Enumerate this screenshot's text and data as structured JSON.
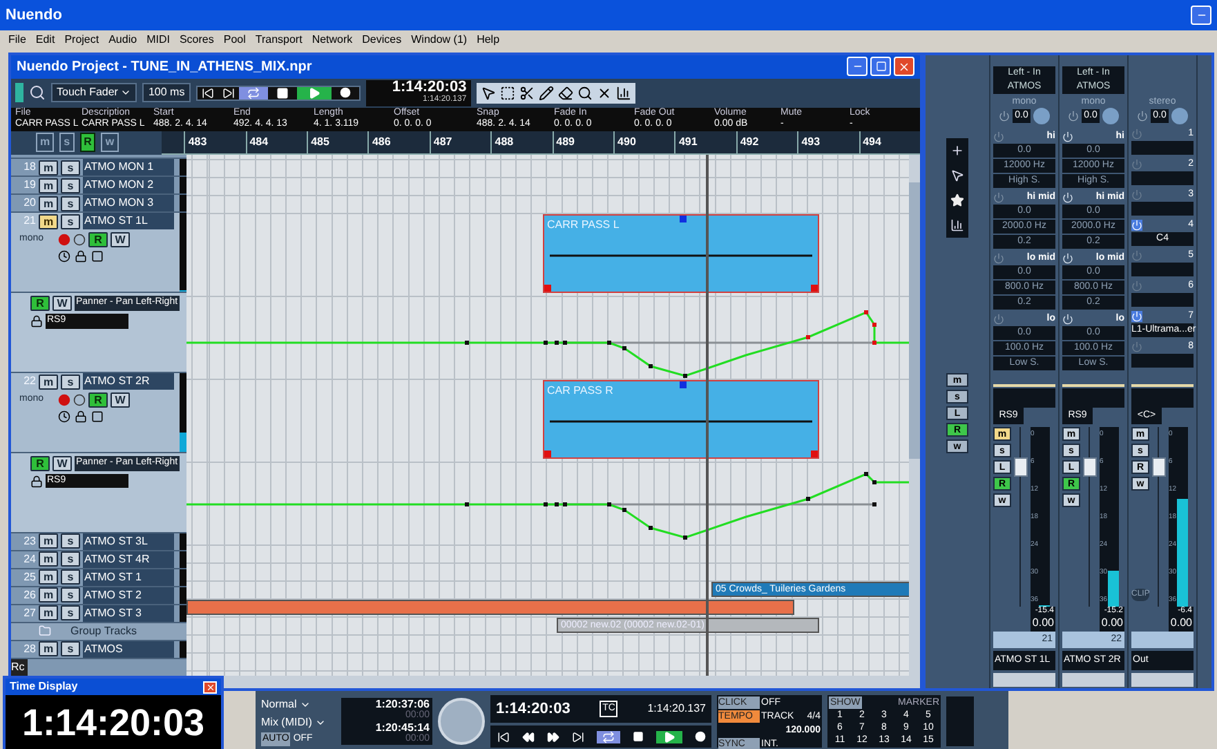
{
  "app": {
    "title": "Nuendo"
  },
  "menu": [
    "File",
    "Edit",
    "Project",
    "Audio",
    "MIDI",
    "Scores",
    "Pool",
    "Transport",
    "Network",
    "Devices",
    "Window (1)",
    "Help"
  ],
  "project": {
    "title": "Nuendo Project - TUNE_IN_ATHENS_MIX.npr",
    "toolbar": {
      "automation_mode": "Touch Fader",
      "fade_time": "100 ms",
      "time": "1:14:20:03",
      "time_secondary": "1:14:20.137",
      "cycle": true,
      "playing": true
    },
    "info": [
      {
        "label": "File",
        "value": "CARR PASS L"
      },
      {
        "label": "Description",
        "value": "CARR PASS L"
      },
      {
        "label": "Start",
        "value": "488. 2. 4. 14"
      },
      {
        "label": "End",
        "value": "492. 4. 4. 13"
      },
      {
        "label": "Length",
        "value": "4. 1. 3.119"
      },
      {
        "label": "Offset",
        "value": "0. 0. 0. 0"
      },
      {
        "label": "Snap",
        "value": "488. 2. 4. 14"
      },
      {
        "label": "Fade In",
        "value": "0. 0. 0. 0"
      },
      {
        "label": "Fade Out",
        "value": "0. 0. 0. 0"
      },
      {
        "label": "Volume",
        "value": "0.00 dB"
      },
      {
        "label": "Mute",
        "value": "-"
      },
      {
        "label": "Lock",
        "value": "-"
      }
    ],
    "header_buttons": [
      {
        "label": "m",
        "on": false
      },
      {
        "label": "s",
        "on": false
      },
      {
        "label": "R",
        "on": true
      },
      {
        "label": "w",
        "on": false
      }
    ],
    "ruler": [
      "483",
      "484",
      "485",
      "486",
      "487",
      "488",
      "489",
      "490",
      "491",
      "492",
      "493",
      "494"
    ],
    "tracks": [
      {
        "kind": "audio",
        "number": "18",
        "name": "ATMO MON 1",
        "buttons": [
          {
            "label": "m",
            "on": false
          },
          {
            "label": "s",
            "on": false
          }
        ]
      },
      {
        "kind": "audio",
        "number": "19",
        "name": "ATMO MON 2",
        "buttons": [
          {
            "label": "m",
            "on": false
          },
          {
            "label": "s",
            "on": false
          }
        ]
      },
      {
        "kind": "audio",
        "number": "20",
        "name": "ATMO MON 3",
        "buttons": [
          {
            "label": "m",
            "on": false
          },
          {
            "label": "s",
            "on": false
          }
        ]
      },
      {
        "kind": "expanded",
        "number": "21",
        "name": "ATMO ST 1L",
        "buttons": [
          {
            "label": "m",
            "on": true
          },
          {
            "label": "s",
            "on": false
          }
        ],
        "mode": "mono",
        "rw": [
          {
            "label": "R",
            "on": true
          },
          {
            "label": "W",
            "on": false
          }
        ],
        "meter": {
          "level": 0
        },
        "event": {
          "name": "CARR PASS L"
        }
      },
      {
        "kind": "automation",
        "parameter": "Panner - Pan Left-Right",
        "value": "RS9",
        "rw": [
          {
            "label": "R",
            "on": true
          },
          {
            "label": "W",
            "on": false
          }
        ]
      },
      {
        "kind": "expanded",
        "number": "22",
        "name": "ATMO ST 2R",
        "buttons": [
          {
            "label": "m",
            "on": false
          },
          {
            "label": "s",
            "on": false
          }
        ],
        "mode": "mono",
        "rw": [
          {
            "label": "R",
            "on": true
          },
          {
            "label": "W",
            "on": false
          }
        ],
        "meter": {
          "level": 0.25
        },
        "event": {
          "name": "CAR PASS R"
        }
      },
      {
        "kind": "automation",
        "parameter": "Panner - Pan Left-Right",
        "value": "RS9",
        "rw": [
          {
            "label": "R",
            "on": true
          },
          {
            "label": "W",
            "on": false
          }
        ]
      },
      {
        "kind": "audio",
        "number": "23",
        "name": "ATMO ST 3L",
        "buttons": [
          {
            "label": "m",
            "on": false
          },
          {
            "label": "s",
            "on": false
          }
        ]
      },
      {
        "kind": "audio",
        "number": "24",
        "name": "ATMO ST 4R",
        "buttons": [
          {
            "label": "m",
            "on": false
          },
          {
            "label": "s",
            "on": false
          }
        ]
      },
      {
        "kind": "audio",
        "number": "25",
        "name": "ATMO ST 1",
        "buttons": [
          {
            "label": "m",
            "on": false
          },
          {
            "label": "s",
            "on": false
          }
        ],
        "event": {
          "name": "05 Crowds_ Tuileries Gardens",
          "color": "#1f7ab8"
        }
      },
      {
        "kind": "audio",
        "number": "26",
        "name": "ATMO ST 2",
        "buttons": [
          {
            "label": "m",
            "on": false
          },
          {
            "label": "s",
            "on": false
          }
        ],
        "event": {
          "color": "#e8704a"
        }
      },
      {
        "kind": "audio",
        "number": "27",
        "name": "ATMO ST 3",
        "buttons": [
          {
            "label": "m",
            "on": false
          },
          {
            "label": "s",
            "on": false
          }
        ],
        "event": {
          "name": "00002 new.02 (00002 new.02-01)",
          "color": "#b4b8bc"
        }
      },
      {
        "kind": "folder",
        "name": "Group Tracks"
      },
      {
        "kind": "audio",
        "number": "28",
        "name": "ATMOS",
        "buttons": [
          {
            "label": "m",
            "on": false
          },
          {
            "label": "s",
            "on": false
          }
        ]
      }
    ],
    "footer": "Rc"
  },
  "mixer": {
    "global_buttons": [
      {
        "label": "m",
        "on": false
      },
      {
        "label": "s",
        "on": false
      },
      {
        "label": "L",
        "on": false
      },
      {
        "label": "R",
        "on": true
      },
      {
        "label": "w",
        "on": false
      }
    ],
    "strips": [
      {
        "kind": "channel",
        "input": "Left - In",
        "output": "ATMOS",
        "mode": "mono",
        "gain": "0.0",
        "eq_enabled": false,
        "eq": [
          {
            "band": "hi",
            "gain": "0.0",
            "freq": "12000 Hz",
            "shape": "High S."
          },
          {
            "band": "hi mid",
            "gain": "0.0",
            "freq": "2000.0 Hz",
            "shape": "0.2"
          },
          {
            "band": "lo mid",
            "gain": "0.0",
            "freq": "800.0 Hz",
            "shape": "0.2"
          },
          {
            "band": "lo",
            "gain": "0.0",
            "freq": "100.0 Hz",
            "shape": "Low S."
          }
        ],
        "pan": "RS9",
        "buttons": [
          {
            "label": "m",
            "on": true
          },
          {
            "label": "s",
            "on": false
          },
          {
            "label": "L",
            "on": false
          },
          {
            "label": "R",
            "on": true
          },
          {
            "label": "w",
            "on": false
          }
        ],
        "scale": [
          "0",
          "6",
          "12",
          "18",
          "24",
          "30",
          "36"
        ],
        "fader": {
          "level": 0.8
        },
        "meter": {
          "level": 0
        },
        "peak": "-15.4",
        "volume": "0.00",
        "number": "21",
        "name": "ATMO ST 1L"
      },
      {
        "kind": "channel",
        "input": "Left - In",
        "output": "ATMOS",
        "mode": "mono",
        "gain": "0.0",
        "eq_enabled": true,
        "eq": [
          {
            "band": "hi",
            "gain": "0.0",
            "freq": "12000 Hz",
            "shape": "High S."
          },
          {
            "band": "hi mid",
            "gain": "0.0",
            "freq": "2000.0 Hz",
            "shape": "0.2"
          },
          {
            "band": "lo mid",
            "gain": "0.0",
            "freq": "800.0 Hz",
            "shape": "0.2"
          },
          {
            "band": "lo",
            "gain": "0.0",
            "freq": "100.0 Hz",
            "shape": "Low S."
          }
        ],
        "pan": "RS9",
        "buttons": [
          {
            "label": "m",
            "on": false
          },
          {
            "label": "s",
            "on": false
          },
          {
            "label": "L",
            "on": false
          },
          {
            "label": "R",
            "on": true
          },
          {
            "label": "w",
            "on": false
          }
        ],
        "scale": [
          "0",
          "6",
          "12",
          "18",
          "24",
          "30",
          "36"
        ],
        "fader": {
          "level": 0.8
        },
        "meter": {
          "level": 0.2
        },
        "peak": "-15.2",
        "volume": "0.00",
        "number": "22",
        "name": "ATMO ST 2R"
      },
      {
        "kind": "output",
        "mode": "stereo",
        "gain": "0.0",
        "inserts": [
          {
            "number": "1",
            "active": false
          },
          {
            "number": "2",
            "active": false
          },
          {
            "number": "3",
            "active": false
          },
          {
            "number": "4",
            "active": true,
            "plugin": "C4"
          },
          {
            "number": "5",
            "active": false
          },
          {
            "number": "6",
            "active": false
          },
          {
            "number": "7",
            "active": true,
            "plugin": "L1-Ultrama...er"
          },
          {
            "number": "8",
            "active": false
          }
        ],
        "pan": "<C>",
        "buttons": [
          {
            "label": "m",
            "on": false
          },
          {
            "label": "s",
            "on": false
          },
          {
            "label": "R",
            "on": false
          },
          {
            "label": "w",
            "on": false
          }
        ],
        "clip": "CLIP",
        "scale": [
          "0",
          "6",
          "12",
          "18",
          "24",
          "30",
          "36"
        ],
        "fader": {
          "level": 0.8
        },
        "meter": {
          "level": 0.6
        },
        "peak": "-6.4",
        "volume": "0.00",
        "name": "Out"
      }
    ]
  },
  "time_display": {
    "title": "Time Display",
    "time": "1:14:20:03"
  },
  "transport": {
    "mode": "Normal",
    "record_mode": "Mix (MIDI)",
    "auto": "AUTO",
    "auto_value": "OFF",
    "left_locator": "1:20:37:06",
    "left_sub": "00:00",
    "right_locator": "1:20:45:14",
    "right_sub": "00:00",
    "position": "1:14:20:03",
    "position_format": "TC",
    "position_secondary": "1:14:20.137",
    "cycle": true,
    "playing": true,
    "click": "CLICK",
    "click_value": "OFF",
    "tempo": "TEMPO",
    "tempo_mode": "TRACK",
    "signature": "4/4",
    "tempo_value": "120.000",
    "sync": "SYNC",
    "sync_value": "INT.",
    "show": "SHOW",
    "marker": "MARKER",
    "markers": [
      "1",
      "2",
      "3",
      "4",
      "5",
      "6",
      "7",
      "8",
      "9",
      "10",
      "11",
      "12",
      "13",
      "14",
      "15"
    ]
  }
}
